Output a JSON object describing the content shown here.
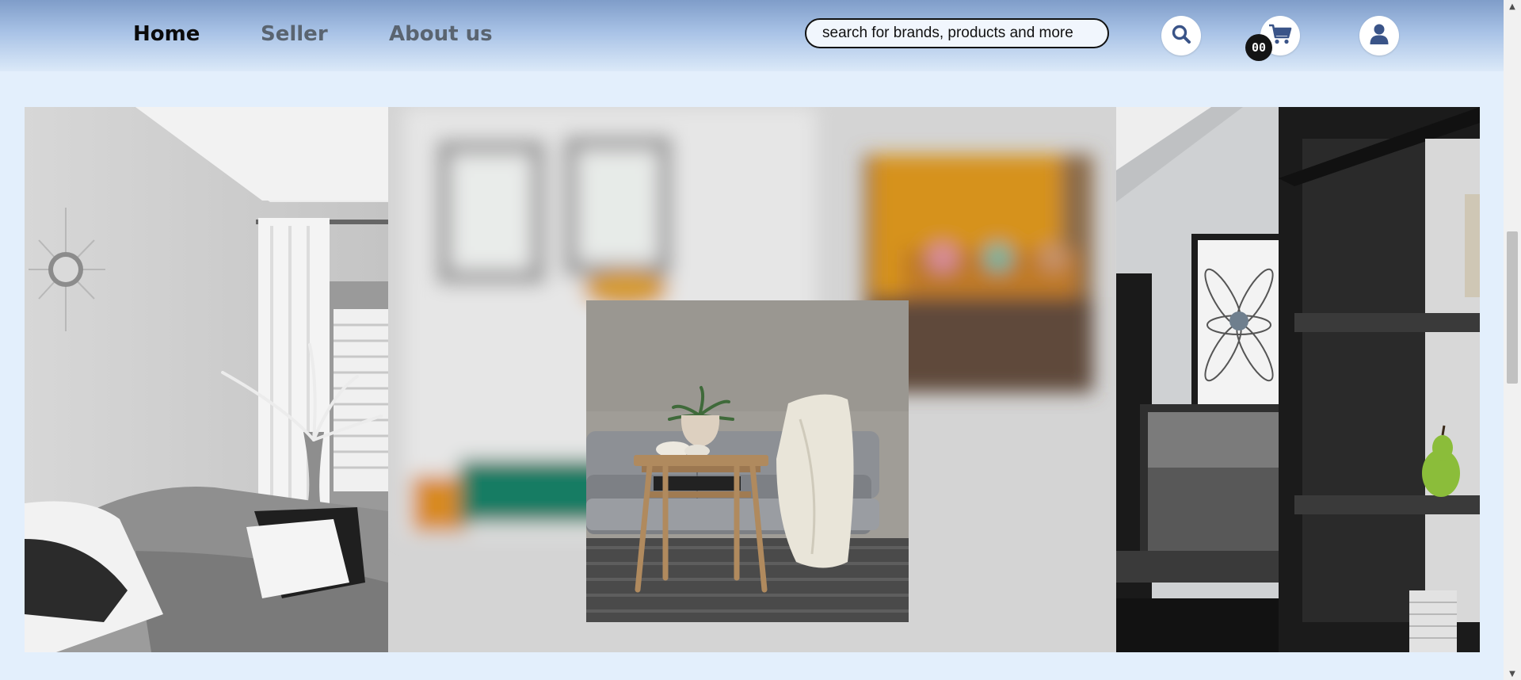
{
  "nav": {
    "links": [
      {
        "label": "Home",
        "active": true
      },
      {
        "label": "Seller",
        "active": false
      },
      {
        "label": "About us",
        "active": false
      }
    ]
  },
  "search": {
    "placeholder": "search for brands, products and more"
  },
  "cart": {
    "count": "00"
  },
  "icons": {
    "search": "search-icon",
    "cart": "cart-icon",
    "user": "user-icon"
  },
  "colors": {
    "icon_blue": "#3a5488",
    "badge": "#141414",
    "page_background": "#e3effc"
  },
  "hero": {
    "panels": [
      "living-room-sofa-photo",
      "blurred-interior-photo",
      "tv-shelf-photo"
    ],
    "featured": "sofa-side-table-photo"
  }
}
